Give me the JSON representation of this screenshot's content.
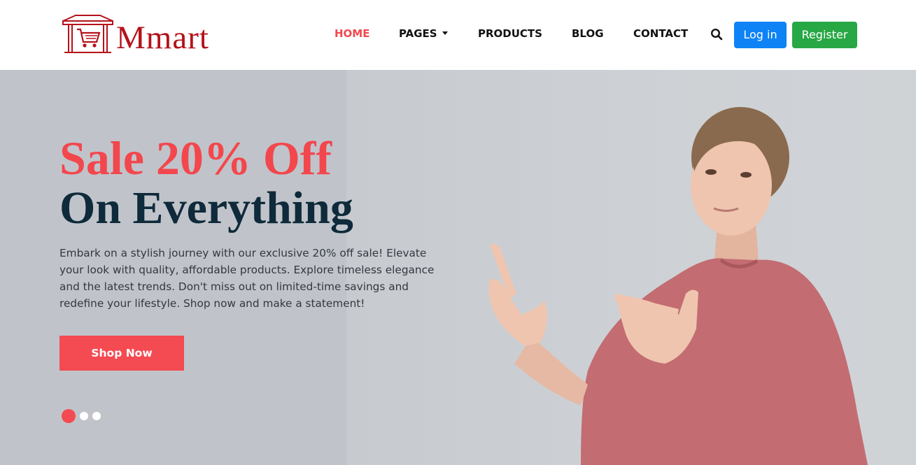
{
  "brand": {
    "name": "Mmart",
    "color": "#b5121b",
    "logo_icon": "shopping-cart-store-icon"
  },
  "nav": {
    "items": [
      {
        "label": "HOME",
        "active": true
      },
      {
        "label": "PAGES",
        "has_dropdown": true
      },
      {
        "label": "PRODUCTS"
      },
      {
        "label": "BLOG"
      },
      {
        "label": "CONTACT"
      }
    ],
    "search_icon": "search-icon",
    "login_label": "Log in",
    "register_label": "Register"
  },
  "hero": {
    "headline_1": "Sale 20% Off",
    "headline_2": "On Everything",
    "description": "Embark on a stylish journey with our exclusive 20% off sale! Elevate your look with quality, affordable products. Explore timeless elegance and the latest trends. Don't miss out on limited-time savings and redefine your lifestyle. Shop now and make a statement!",
    "cta_label": "Shop Now",
    "slides": {
      "count": 3,
      "active_index": 0
    }
  },
  "colors": {
    "accent": "#f44a51",
    "headline_dark": "#0f2a3a",
    "login_blue": "#0d83f5",
    "register_green": "#28a745",
    "hero_bg": "#c0c4ca"
  }
}
